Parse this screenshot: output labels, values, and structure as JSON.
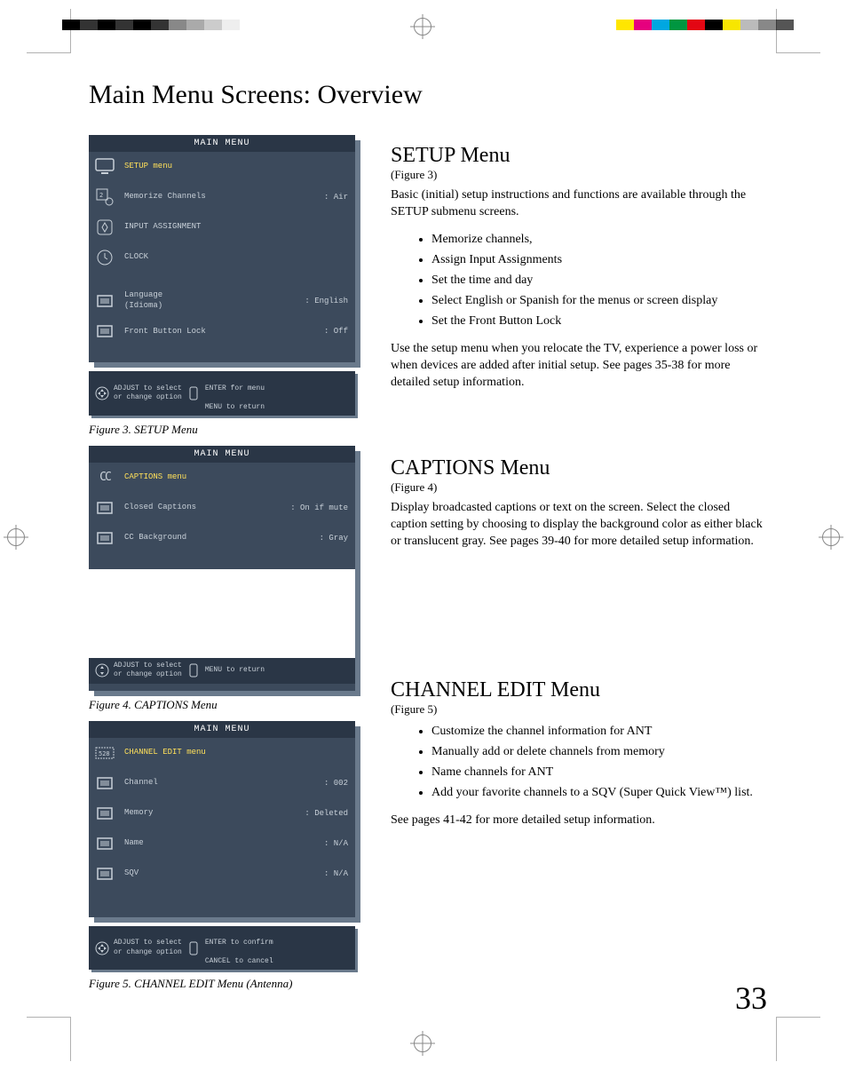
{
  "page_title": "Main Menu Screens: Overview",
  "page_number": "33",
  "figures": {
    "fig3": {
      "caption": "Figure 3.  SETUP Menu",
      "menu_title": "MAIN MENU",
      "rows": [
        {
          "label": "SETUP menu",
          "value": "",
          "icon": "tv-icon",
          "hl": true
        },
        {
          "label": "Memorize Channels",
          "value": ": Air",
          "icon": "channels-icon"
        },
        {
          "label": "INPUT ASSIGNMENT",
          "value": "",
          "icon": "input-icon"
        },
        {
          "label": "CLOCK",
          "value": "",
          "icon": "clock-icon"
        },
        {
          "label": "Language\n(Idioma)",
          "value": ": English",
          "icon": "box-icon",
          "spacer_before": true
        },
        {
          "label": "Front Button Lock",
          "value": ": Off",
          "icon": "box-icon"
        }
      ],
      "footer": {
        "left": "ADJUST to select\nor change option",
        "mid": "ENTER for menu",
        "right": "MENU  to  return"
      }
    },
    "fig4": {
      "caption": "Figure 4.  CAPTIONS Menu",
      "menu_title": "MAIN MENU",
      "rows": [
        {
          "label": "CAPTIONS menu",
          "value": "",
          "icon": "cc-icon",
          "hl": true
        },
        {
          "label": "Closed Captions",
          "value": ": On if mute",
          "icon": "box-icon"
        },
        {
          "label": "CC Background",
          "value": ": Gray",
          "icon": "box-icon"
        }
      ],
      "footer": {
        "left": "ADJUST to select\nor change option",
        "mid": "",
        "right": "MENU  to  return"
      }
    },
    "fig5": {
      "caption": "Figure 5.  CHANNEL EDIT Menu (Antenna)",
      "menu_title": "MAIN MENU",
      "rows": [
        {
          "label": "CHANNEL EDIT menu",
          "value": "",
          "icon": "chedit-icon",
          "hl": true
        },
        {
          "label": "Channel",
          "value": ": 002",
          "icon": "box-icon"
        },
        {
          "label": "Memory",
          "value": ": Deleted",
          "icon": "box-icon"
        },
        {
          "label": "Name",
          "value": ": N/A",
          "icon": "box-icon"
        },
        {
          "label": "SQV",
          "value": ": N/A",
          "icon": "box-icon"
        }
      ],
      "footer": {
        "left": "ADJUST to select\nor change option",
        "mid": "ENTER to confirm",
        "right": "CANCEL to cancel"
      }
    }
  },
  "sections": {
    "setup": {
      "heading": "SETUP Menu",
      "figref": "(Figure 3)",
      "intro": "Basic (initial) setup instructions and functions are available through the SETUP submenu screens.",
      "bullets": [
        "Memorize channels,",
        "Assign Input Assignments",
        "Set the time and day",
        "Select English or Spanish for the menus or screen display",
        "Set the Front Button Lock"
      ],
      "outro": "Use the setup menu when you relocate the TV, experience a power loss or when devices are added after initial setup.  See pages 35-38 for more detailed setup information."
    },
    "captions": {
      "heading": "CAPTIONS Menu",
      "figref": "(Figure 4)",
      "body": "Display broadcasted captions or text on the screen. Select the closed caption setting by choosing to display the background color as either black or translucent gray.  See pages 39-40 for more detailed setup information."
    },
    "channel": {
      "heading": "CHANNEL EDIT Menu",
      "figref": "(Figure 5)",
      "bullets": [
        "Customize the channel information for ANT",
        "Manually add or delete channels from memory",
        "Name channels for ANT",
        "Add your favorite channels to a SQV (Super Quick View™) list."
      ],
      "outro": "See pages 41-42 for more detailed setup information."
    }
  },
  "colorbars": {
    "left": [
      "#000",
      "#333",
      "#000",
      "#333",
      "#000",
      "#333",
      "#888",
      "#aaa",
      "#ccc",
      "#eee"
    ],
    "right": [
      "#ffe600",
      "#e6007e",
      "#00a7e1",
      "#009640",
      "#e30613",
      "#000",
      "#ffe600",
      "#bbb",
      "#888",
      "#555"
    ]
  }
}
